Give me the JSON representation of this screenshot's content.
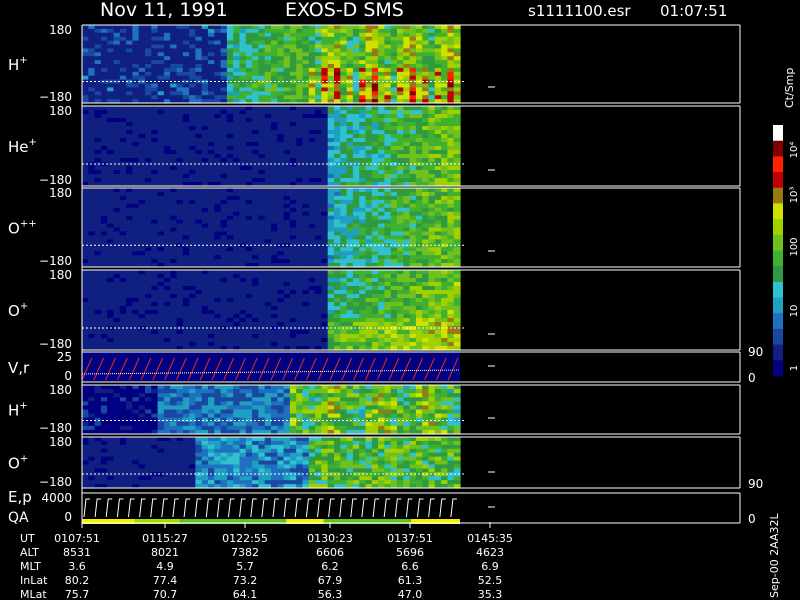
{
  "header": {
    "date": "Nov 11, 1991",
    "mission": "EXOS-D SMS",
    "file": "s1111100.esr",
    "time": "01:07:51"
  },
  "colorbar": {
    "title": "Ct/Smp",
    "tick_labels": [
      "10⁴",
      "10³",
      "100",
      "10",
      "1"
    ],
    "colors": [
      "#000080",
      "#102080",
      "#1848a0",
      "#2070c0",
      "#20a0c0",
      "#30c0d0",
      "#2f9a40",
      "#3fb030",
      "#70c020",
      "#a0d000",
      "#d0e000",
      "#9a7a10",
      "#c00000",
      "#ff2000",
      "#800000",
      "#ffffff"
    ]
  },
  "footer_right": "Sep-00 2AA32L",
  "chart_data": {
    "type": "heatmap",
    "time_ticks": [
      "0107:51",
      "0115:27",
      "0122:55",
      "0130:23",
      "0137:51",
      "0145:35"
    ],
    "panels": [
      {
        "label": "H",
        "superscript": "+",
        "ymin": "−180",
        "ymax": "180"
      },
      {
        "label": "He",
        "superscript": "+",
        "ymin": "−180",
        "ymax": "180"
      },
      {
        "label": "O",
        "superscript": "++",
        "ymin": "−180",
        "ymax": "180"
      },
      {
        "label": "O",
        "superscript": "+",
        "ymin": "−180",
        "ymax": "180"
      },
      {
        "label": "V,r",
        "superscript": "",
        "ymin": "0",
        "ymax": "25",
        "right_top": "90",
        "right_bottom": "0"
      },
      {
        "label": "H",
        "superscript": "+",
        "ymin": "−180",
        "ymax": "180"
      },
      {
        "label": "O",
        "superscript": "+",
        "ymin": "−180",
        "ymax": "180",
        "right_bottom": "90"
      },
      {
        "label": "E,p",
        "label2": "QA",
        "superscript": "",
        "ymin": "0",
        "ymax": "4000",
        "right_bottom": "0"
      }
    ],
    "orbit_rows": [
      {
        "label": "UT",
        "values": [
          "0107:51",
          "0115:27",
          "0122:55",
          "0130:23",
          "0137:51",
          "0145:35"
        ]
      },
      {
        "label": "ALT",
        "values": [
          "8531",
          "8021",
          "7382",
          "6606",
          "5696",
          "4623"
        ]
      },
      {
        "label": "MLT",
        "values": [
          "3.6",
          "4.9",
          "5.7",
          "6.2",
          "6.6",
          "6.9"
        ]
      },
      {
        "label": "InLat",
        "values": [
          "80.2",
          "77.4",
          "73.2",
          "67.9",
          "61.3",
          "52.5"
        ]
      },
      {
        "label": "MLat",
        "values": [
          "75.7",
          "70.7",
          "64.1",
          "56.3",
          "47.0",
          "35.3"
        ]
      }
    ]
  }
}
